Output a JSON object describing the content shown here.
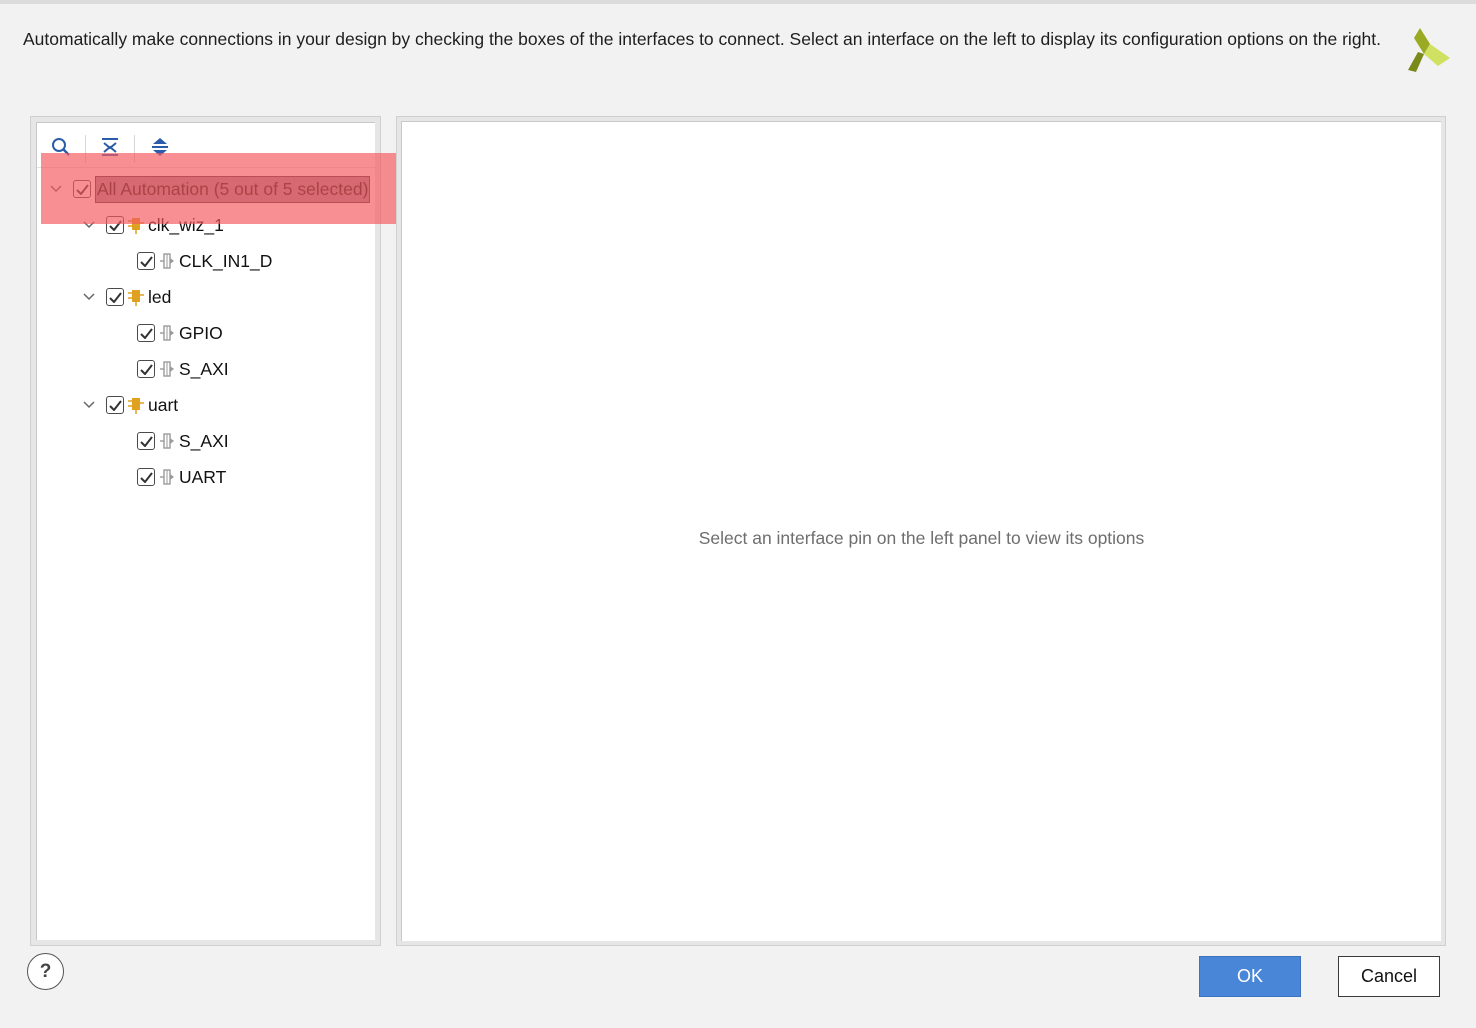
{
  "description": "Automatically make connections in your design by checking the boxes of the interfaces to connect. Select an interface on the left to display its configuration options on the right.",
  "logo_icon": "xilinx-logo",
  "toolbar": {
    "icons": [
      "search-icon",
      "collapse-all-icon",
      "expand-all-icon"
    ]
  },
  "tree": {
    "root": {
      "label": "All Automation (5 out of 5 selected)",
      "checked": true
    },
    "clk_wiz": {
      "label": "clk_wiz_1",
      "checked": true,
      "children": [
        {
          "label": "CLK_IN1_D",
          "checked": true
        }
      ]
    },
    "led": {
      "label": "led",
      "checked": true,
      "children": [
        {
          "label": "GPIO",
          "checked": true
        },
        {
          "label": "S_AXI",
          "checked": true
        }
      ]
    },
    "uart": {
      "label": "uart",
      "checked": true,
      "children": [
        {
          "label": "S_AXI",
          "checked": true
        },
        {
          "label": "UART",
          "checked": true
        }
      ]
    }
  },
  "right_panel": {
    "hint": "Select an interface pin on the left panel to view its options"
  },
  "buttons": {
    "help": "?",
    "ok": "OK",
    "cancel": "Cancel"
  },
  "colors": {
    "accent": "#4a86d8",
    "highlight": "#f55a5f",
    "block_icon": "#e0a020",
    "logo_dark": "#7a8a1a",
    "logo_light": "#c8dc50"
  }
}
